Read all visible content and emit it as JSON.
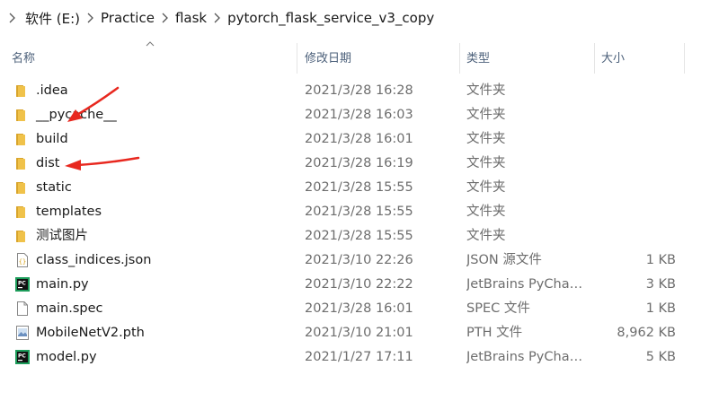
{
  "breadcrumb": {
    "items": [
      "软件 (E:)",
      "Practice",
      "flask",
      "pytorch_flask_service_v3_copy"
    ]
  },
  "columns": {
    "name": "名称",
    "modified": "修改日期",
    "type": "类型",
    "size": "大小"
  },
  "files": [
    {
      "name": ".idea",
      "date": "2021/3/28 16:28",
      "type": "文件夹",
      "size": "",
      "icon": "folder-icon"
    },
    {
      "name": "__pycache__",
      "date": "2021/3/28 16:03",
      "type": "文件夹",
      "size": "",
      "icon": "folder-icon"
    },
    {
      "name": "build",
      "date": "2021/3/28 16:01",
      "type": "文件夹",
      "size": "",
      "icon": "folder-icon"
    },
    {
      "name": "dist",
      "date": "2021/3/28 16:19",
      "type": "文件夹",
      "size": "",
      "icon": "folder-icon"
    },
    {
      "name": "static",
      "date": "2021/3/28 15:55",
      "type": "文件夹",
      "size": "",
      "icon": "folder-icon"
    },
    {
      "name": "templates",
      "date": "2021/3/28 15:55",
      "type": "文件夹",
      "size": "",
      "icon": "folder-icon"
    },
    {
      "name": "测试图片",
      "date": "2021/3/28 15:55",
      "type": "文件夹",
      "size": "",
      "icon": "folder-icon"
    },
    {
      "name": "class_indices.json",
      "date": "2021/3/10 22:26",
      "type": "JSON 源文件",
      "size": "1 KB",
      "icon": "json-file-icon"
    },
    {
      "name": "main.py",
      "date": "2021/3/10 22:22",
      "type": "JetBrains PyCharm",
      "size": "3 KB",
      "icon": "pycharm-file-icon"
    },
    {
      "name": "main.spec",
      "date": "2021/3/28 16:01",
      "type": "SPEC 文件",
      "size": "1 KB",
      "icon": "blank-file-icon"
    },
    {
      "name": "MobileNetV2.pth",
      "date": "2021/3/10 21:01",
      "type": "PTH 文件",
      "size": "8,962 KB",
      "icon": "image-file-icon"
    },
    {
      "name": "model.py",
      "date": "2021/1/27 17:11",
      "type": "JetBrains PyCharm",
      "size": "5 KB",
      "icon": "pycharm-file-icon"
    }
  ],
  "colors": {
    "folder": "#e8b93d",
    "annotation_arrow": "#e8281f",
    "header_text": "#4c607a"
  }
}
